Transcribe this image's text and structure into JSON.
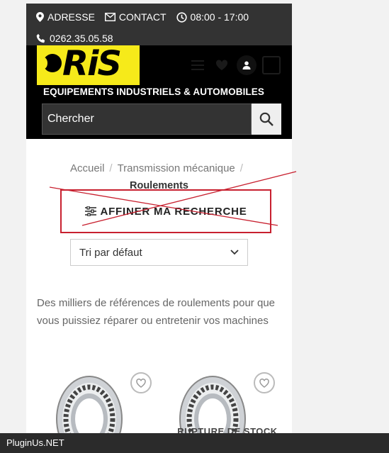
{
  "topbar": {
    "address": "ADRESSE",
    "contact": "CONTACT",
    "hours": "08:00 - 17:00",
    "phone": "0262.35.05.58"
  },
  "header": {
    "logo_text": "RiS",
    "tagline": "EQUIPEMENTS INDUSTRIELS & AUTOMOBILES",
    "search_placeholder": "Chercher"
  },
  "breadcrumb": {
    "items": [
      "Accueil",
      "Transmission mécanique"
    ],
    "current": "Roulements"
  },
  "filter": {
    "refine_label": "AFFINER MA RECHERCHE"
  },
  "sort": {
    "selected": "Tri par défaut"
  },
  "category": {
    "description": "Des milliers de références de roulements pour que vous puissiez réparer ou entretenir vos machines"
  },
  "products": [
    {
      "badge": ""
    },
    {
      "badge": "RUPTURE DE STOCK"
    }
  ],
  "footer": {
    "credit": "PluginUs.NET"
  },
  "colors": {
    "topbar_bg": "#333333",
    "logo_yellow": "#f6ea1a",
    "annotation_red": "#c8202f"
  }
}
